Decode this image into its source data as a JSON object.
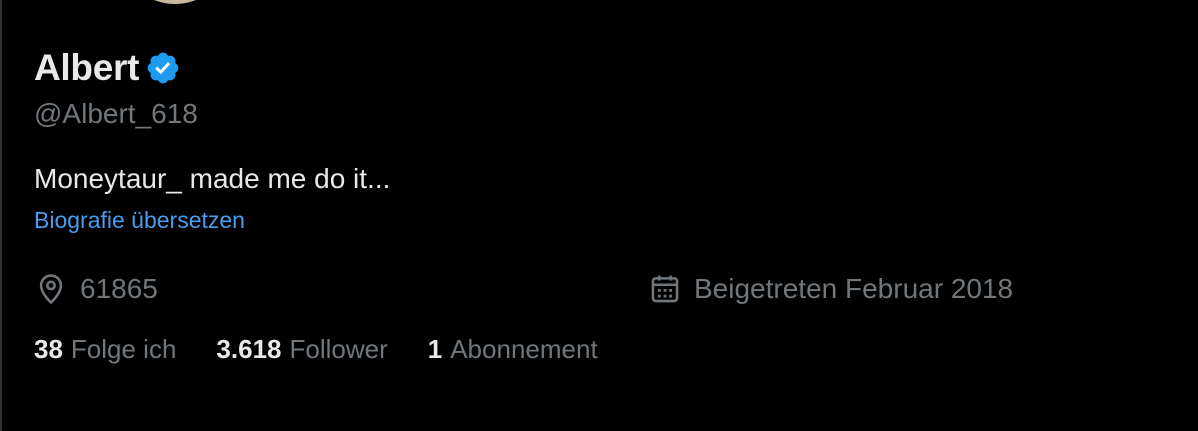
{
  "profile": {
    "display_name": "Albert",
    "handle": "@Albert_618",
    "bio": "Moneytaur_ made me do it...",
    "translate_label": "Biografie übersetzen",
    "location": "61865",
    "joined": "Beigetreten Februar 2018"
  },
  "stats": {
    "following_count": "38",
    "following_label": "Folge ich",
    "followers_count": "3.618",
    "followers_label": "Follower",
    "subscriptions_count": "1",
    "subscriptions_label": "Abonnement"
  },
  "icons": {
    "verified": "verified-badge-icon",
    "location": "location-pin-icon",
    "calendar": "calendar-icon"
  },
  "colors": {
    "background": "#000000",
    "primary_text": "#e7e9ea",
    "secondary_text": "#71767b",
    "link": "#4a9ded",
    "verified": "#1d9bf0"
  }
}
